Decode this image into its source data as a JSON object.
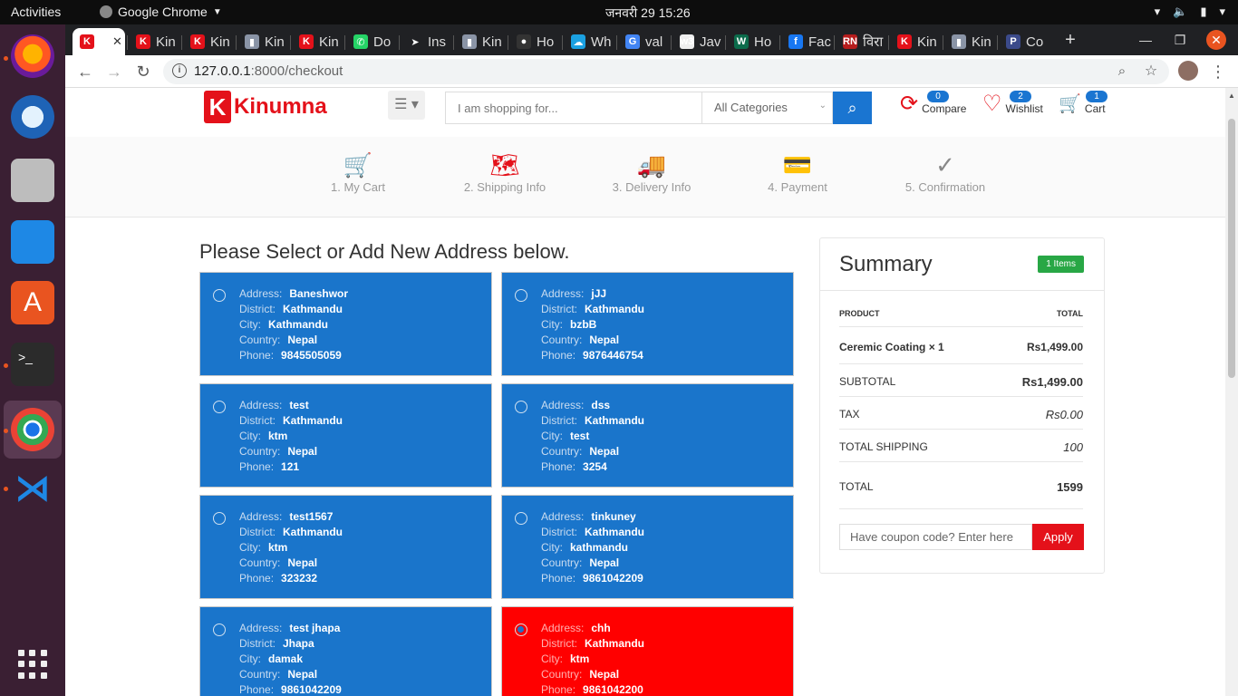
{
  "topbar": {
    "activities": "Activities",
    "app": "Google Chrome",
    "clock": "जनवरी 29  15:26"
  },
  "tabs": [
    {
      "title": "",
      "fav": "K",
      "color": "#e4111a"
    },
    {
      "title": "Kin",
      "fav": "K",
      "color": "#e4111a"
    },
    {
      "title": "Kin",
      "fav": "K",
      "color": "#e4111a"
    },
    {
      "title": "Kin",
      "fav": "▮",
      "color": "#8a94a6"
    },
    {
      "title": "Kin",
      "fav": "K",
      "color": "#e4111a"
    },
    {
      "title": "Do",
      "fav": "✆",
      "color": "#25d366"
    },
    {
      "title": "Ins",
      "fav": "➤",
      "color": "#202124"
    },
    {
      "title": "Kin",
      "fav": "▮",
      "color": "#8a94a6"
    },
    {
      "title": "Ho",
      "fav": "●",
      "color": "#333"
    },
    {
      "title": "Wh",
      "fav": "☁",
      "color": "#1ba1e2"
    },
    {
      "title": "val",
      "fav": "G",
      "color": "#4285f4"
    },
    {
      "title": "Jav",
      "fav": "w3",
      "color": "#eee"
    },
    {
      "title": "Ho",
      "fav": "W",
      "color": "#0b6b4b"
    },
    {
      "title": "Fac",
      "fav": "f",
      "color": "#1877f2"
    },
    {
      "title": "विरा",
      "fav": "RN",
      "color": "#b71c1c"
    },
    {
      "title": "Kin",
      "fav": "K",
      "color": "#e4111a"
    },
    {
      "title": "Kin",
      "fav": "▮",
      "color": "#8a94a6"
    },
    {
      "title": "Co",
      "fav": "P",
      "color": "#3b4a8a"
    }
  ],
  "address_bar": {
    "host": "127.0.0.1",
    "path": ":8000/checkout"
  },
  "header": {
    "logo_letter": "K",
    "logo_name": "Kinumna",
    "search_placeholder": "I am shopping for...",
    "category": "All Categories",
    "compare": {
      "label": "Compare",
      "count": "0"
    },
    "wishlist": {
      "label": "Wishlist",
      "count": "2"
    },
    "cart": {
      "label": "Cart",
      "count": "1"
    }
  },
  "steps": [
    {
      "label": "1. My Cart",
      "icon": "cart-icon",
      "glyph": "🛒"
    },
    {
      "label": "2. Shipping Info",
      "icon": "map-icon",
      "glyph": "🗺"
    },
    {
      "label": "3. Delivery Info",
      "icon": "truck-icon",
      "glyph": "🚚"
    },
    {
      "label": "4. Payment",
      "icon": "card-icon",
      "glyph": "💳"
    },
    {
      "label": "5. Confirmation",
      "icon": "check-circle-icon",
      "glyph": "✓"
    }
  ],
  "select_title": "Please Select or Add New Address below.",
  "labels": {
    "address": "Address:",
    "district": "District:",
    "city": "City:",
    "country": "Country:",
    "phone": "Phone:"
  },
  "addresses": [
    {
      "address": "Baneshwor",
      "district": "Kathmandu",
      "city": "Kathmandu",
      "country": "Nepal",
      "phone": "9845505059",
      "selected": false
    },
    {
      "address": "jJJ",
      "district": "Kathmandu",
      "city": "bzbB",
      "country": "Nepal",
      "phone": "9876446754",
      "selected": false
    },
    {
      "address": "test",
      "district": "Kathmandu",
      "city": "ktm",
      "country": "Nepal",
      "phone": "121",
      "selected": false
    },
    {
      "address": "dss",
      "district": "Kathmandu",
      "city": "test",
      "country": "Nepal",
      "phone": "3254",
      "selected": false
    },
    {
      "address": "test1567",
      "district": "Kathmandu",
      "city": "ktm",
      "country": "Nepal",
      "phone": "323232",
      "selected": false
    },
    {
      "address": "tinkuney",
      "district": "Kathmandu",
      "city": "kathmandu",
      "country": "Nepal",
      "phone": "9861042209",
      "selected": false
    },
    {
      "address": "test jhapa",
      "district": "Jhapa",
      "city": "damak",
      "country": "Nepal",
      "phone": "9861042209",
      "selected": false
    },
    {
      "address": "chh",
      "district": "Kathmandu",
      "city": "ktm",
      "country": "Nepal",
      "phone": "9861042200",
      "selected": true
    }
  ],
  "summary": {
    "title": "Summary",
    "items_badge": "1 Items",
    "col_product": "PRODUCT",
    "col_total": "TOTAL",
    "product_name": "Ceremic Coating",
    "product_qty": "× 1",
    "product_total": "Rs1,499.00",
    "subtotal_label": "SUBTOTAL",
    "subtotal": "Rs1,499.00",
    "tax_label": "TAX",
    "tax": "Rs0.00",
    "shipping_label": "TOTAL SHIPPING",
    "shipping": "100",
    "total_label": "TOTAL",
    "total": "1599",
    "coupon_placeholder": "Have coupon code? Enter here",
    "apply_label": "Apply"
  }
}
